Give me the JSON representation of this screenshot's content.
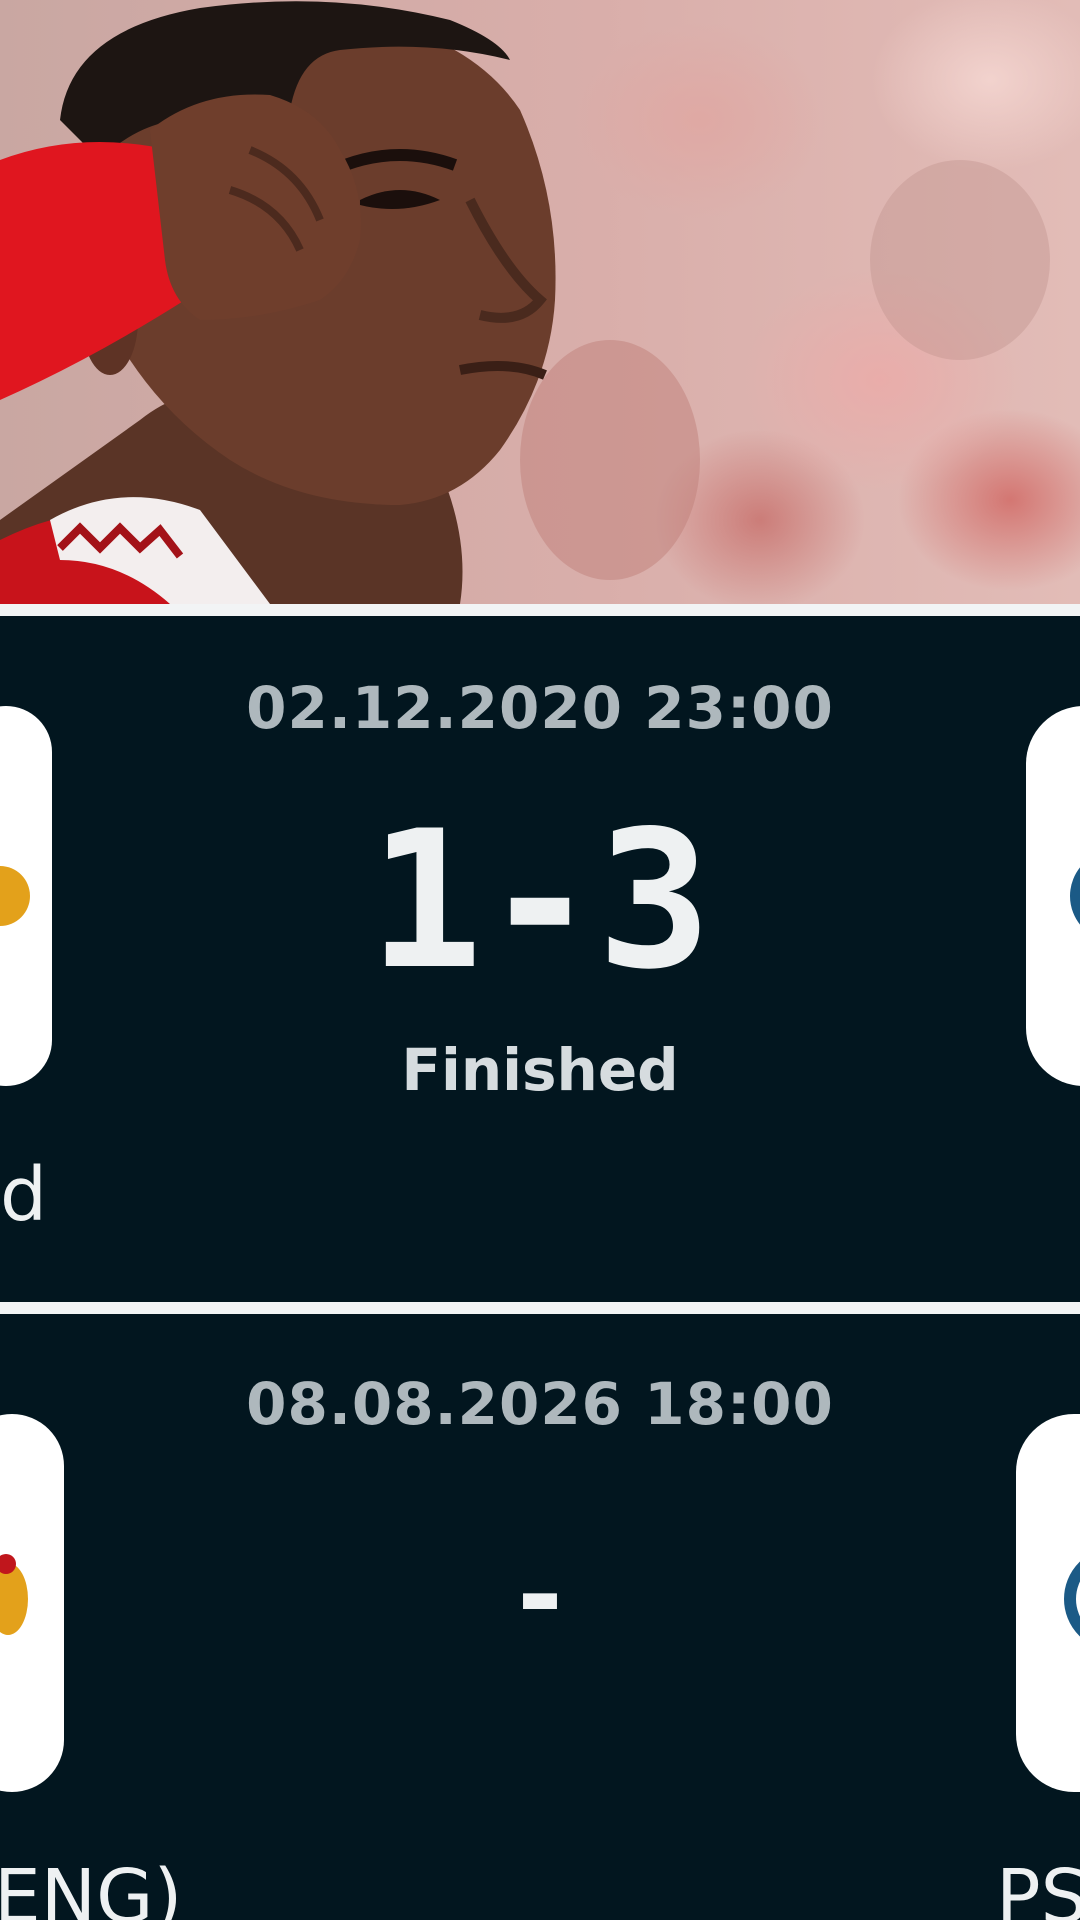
{
  "hero": {
    "icon": "player-celebration-photo"
  },
  "matches": [
    {
      "datetime": "02.12.2020 23:00",
      "score": "1-3",
      "status": "Finished",
      "home_team_partial": "d",
      "away_team_partial": ""
    },
    {
      "datetime": "08.08.2026 18:00",
      "score": "-",
      "status": "",
      "home_team_partial": "ENG)",
      "away_team_partial": "PS"
    }
  ],
  "colors": {
    "card_background": "#02161f",
    "divider": "#f2f4f5",
    "datetime_text": "#aeb8bd",
    "score_text": "#eef1f2"
  }
}
